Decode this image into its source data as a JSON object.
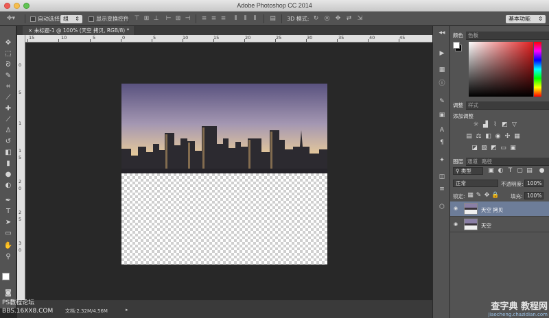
{
  "window": {
    "title": "Adobe Photoshop CC 2014"
  },
  "options": {
    "auto_select_label": "自动选择:",
    "auto_select_value": "组",
    "show_transform_label": "显示变换控件",
    "mode_3d_label": "3D 模式:",
    "workspace": "基本功能"
  },
  "document": {
    "tab_title": "未标题-1 @ 100% (天空 拷贝, RGB/8) *",
    "status": "文档:2.32M/4.56M"
  },
  "rulers": {
    "h_labels": [
      "15",
      "10",
      "5",
      "0",
      "5",
      "10",
      "15",
      "20",
      "25",
      "30",
      "35",
      "40",
      "45"
    ],
    "v_labels": [
      "0",
      "5",
      "1",
      "1",
      "5",
      "2",
      "0",
      "2",
      "5",
      "3",
      "0"
    ]
  },
  "panels": {
    "color_tabs": [
      "颜色",
      "色板"
    ],
    "adjust_tabs": [
      "调整",
      "样式"
    ],
    "adjust_title": "添加调整",
    "layers_tabs": [
      "图层",
      "通道",
      "路径"
    ],
    "filter_kind": "类型",
    "blend_mode": "正常",
    "opacity_label": "不透明度:",
    "opacity_value": "100%",
    "lock_label": "锁定:",
    "fill_label": "填充:",
    "fill_value": "100%",
    "layers": [
      {
        "name": "天空 拷贝",
        "selected": true
      },
      {
        "name": "天空",
        "selected": false
      }
    ]
  },
  "watermarks": {
    "left_line1": "PS教程论坛",
    "left_line2": "BBS.16XX8.COM",
    "right_main": "查字典 教程网",
    "right_sub": "jiaocheng.chazidian.com"
  },
  "icons": {
    "tools": [
      "move-icon",
      "marquee-icon",
      "lasso-icon",
      "quick-select-icon",
      "crop-icon",
      "eyedropper-icon",
      "healing-icon",
      "brush-icon",
      "stamp-icon",
      "history-brush-icon",
      "eraser-icon",
      "gradient-icon",
      "blur-icon",
      "dodge-icon",
      "pen-icon",
      "type-icon",
      "path-select-icon",
      "rectangle-icon",
      "hand-icon",
      "zoom-icon"
    ]
  }
}
